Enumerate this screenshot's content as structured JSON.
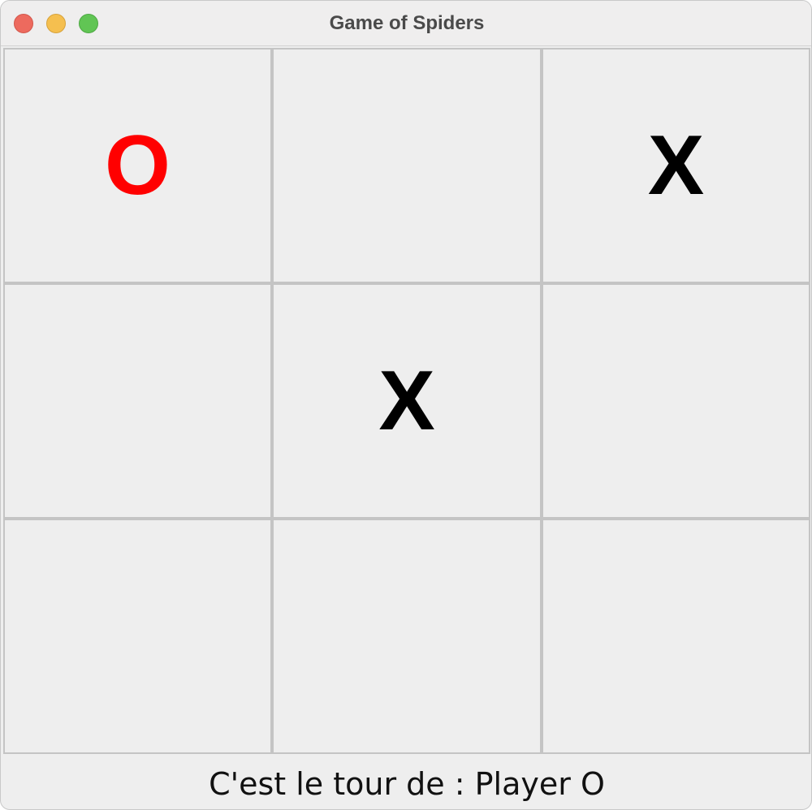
{
  "window": {
    "title": "Game of Spiders",
    "controls": [
      "close",
      "minimize",
      "zoom"
    ]
  },
  "board": {
    "cells": [
      {
        "mark": "O",
        "color": "#ff0000"
      },
      {
        "mark": "",
        "color": "#000000"
      },
      {
        "mark": "X",
        "color": "#000000"
      },
      {
        "mark": "",
        "color": "#000000"
      },
      {
        "mark": "X",
        "color": "#000000"
      },
      {
        "mark": "",
        "color": "#000000"
      },
      {
        "mark": "",
        "color": "#000000"
      },
      {
        "mark": "",
        "color": "#000000"
      },
      {
        "mark": "",
        "color": "#000000"
      }
    ]
  },
  "status": {
    "text": "C'est le tour de : Player O"
  }
}
